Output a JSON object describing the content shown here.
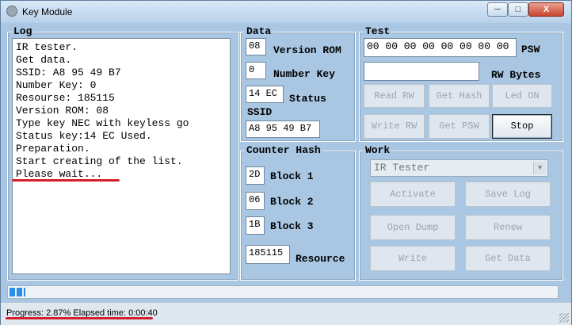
{
  "window": {
    "title": "Key Module",
    "minimize": "─",
    "maximize": "□",
    "close": "X"
  },
  "log": {
    "title": "Log",
    "lines": [
      "IR tester.",
      "Get data.",
      "SSID: A8 95 49 B7",
      "Number Key: 0",
      "Resourse: 185115",
      "Version ROM: 08",
      "Type key NEC with keyless go",
      "Status key:14 EC Used.",
      "Preparation.",
      "Start creating of the list.",
      "Please wait..."
    ]
  },
  "data": {
    "title": "Data",
    "version_rom_label": "Version ROM",
    "version_rom_value": "08",
    "number_key_label": "Number Key",
    "number_key_value": "0",
    "status_label": "Status",
    "status_value": "14 EC",
    "ssid_label": "SSID",
    "ssid_value": "A8 95 49 B7"
  },
  "test": {
    "title": "Test",
    "psw_value": "00 00 00 00 00 00 00 00",
    "psw_label": "PSW",
    "rw_bytes_value": "",
    "rw_bytes_label": "RW Bytes",
    "buttons": {
      "read_rw": "Read RW",
      "get_hash": "Get Hash",
      "led_on": "Led ON",
      "write_rw": "Write RW",
      "get_psw": "Get PSW",
      "stop": "Stop"
    }
  },
  "counter_hash": {
    "title": "Counter Hash",
    "block1_value": "2D",
    "block1_label": "Block 1",
    "block2_value": "06",
    "block2_label": "Block 2",
    "block3_value": "1B",
    "block3_label": "Block 3",
    "resource_value": "185115",
    "resource_label": "Resource"
  },
  "work": {
    "title": "Work",
    "mode_selected": "IR Tester",
    "buttons": {
      "activate": "Activate",
      "save_log": "Save Log",
      "open_dump": "Open Dump",
      "renew": "Renew",
      "write": "Write",
      "get_data": "Get Data"
    }
  },
  "progress": {
    "fraction": 0.0287,
    "status_text": "Progress: 2.87% Elapsed time: 0:00:40"
  },
  "icons": {
    "app": "key-module-icon",
    "dropdown": "chevron-down-icon",
    "grip": "resize-grip-icon"
  },
  "colors": {
    "accent_underline": "#d3202b",
    "progress": "#2a8ee8"
  }
}
